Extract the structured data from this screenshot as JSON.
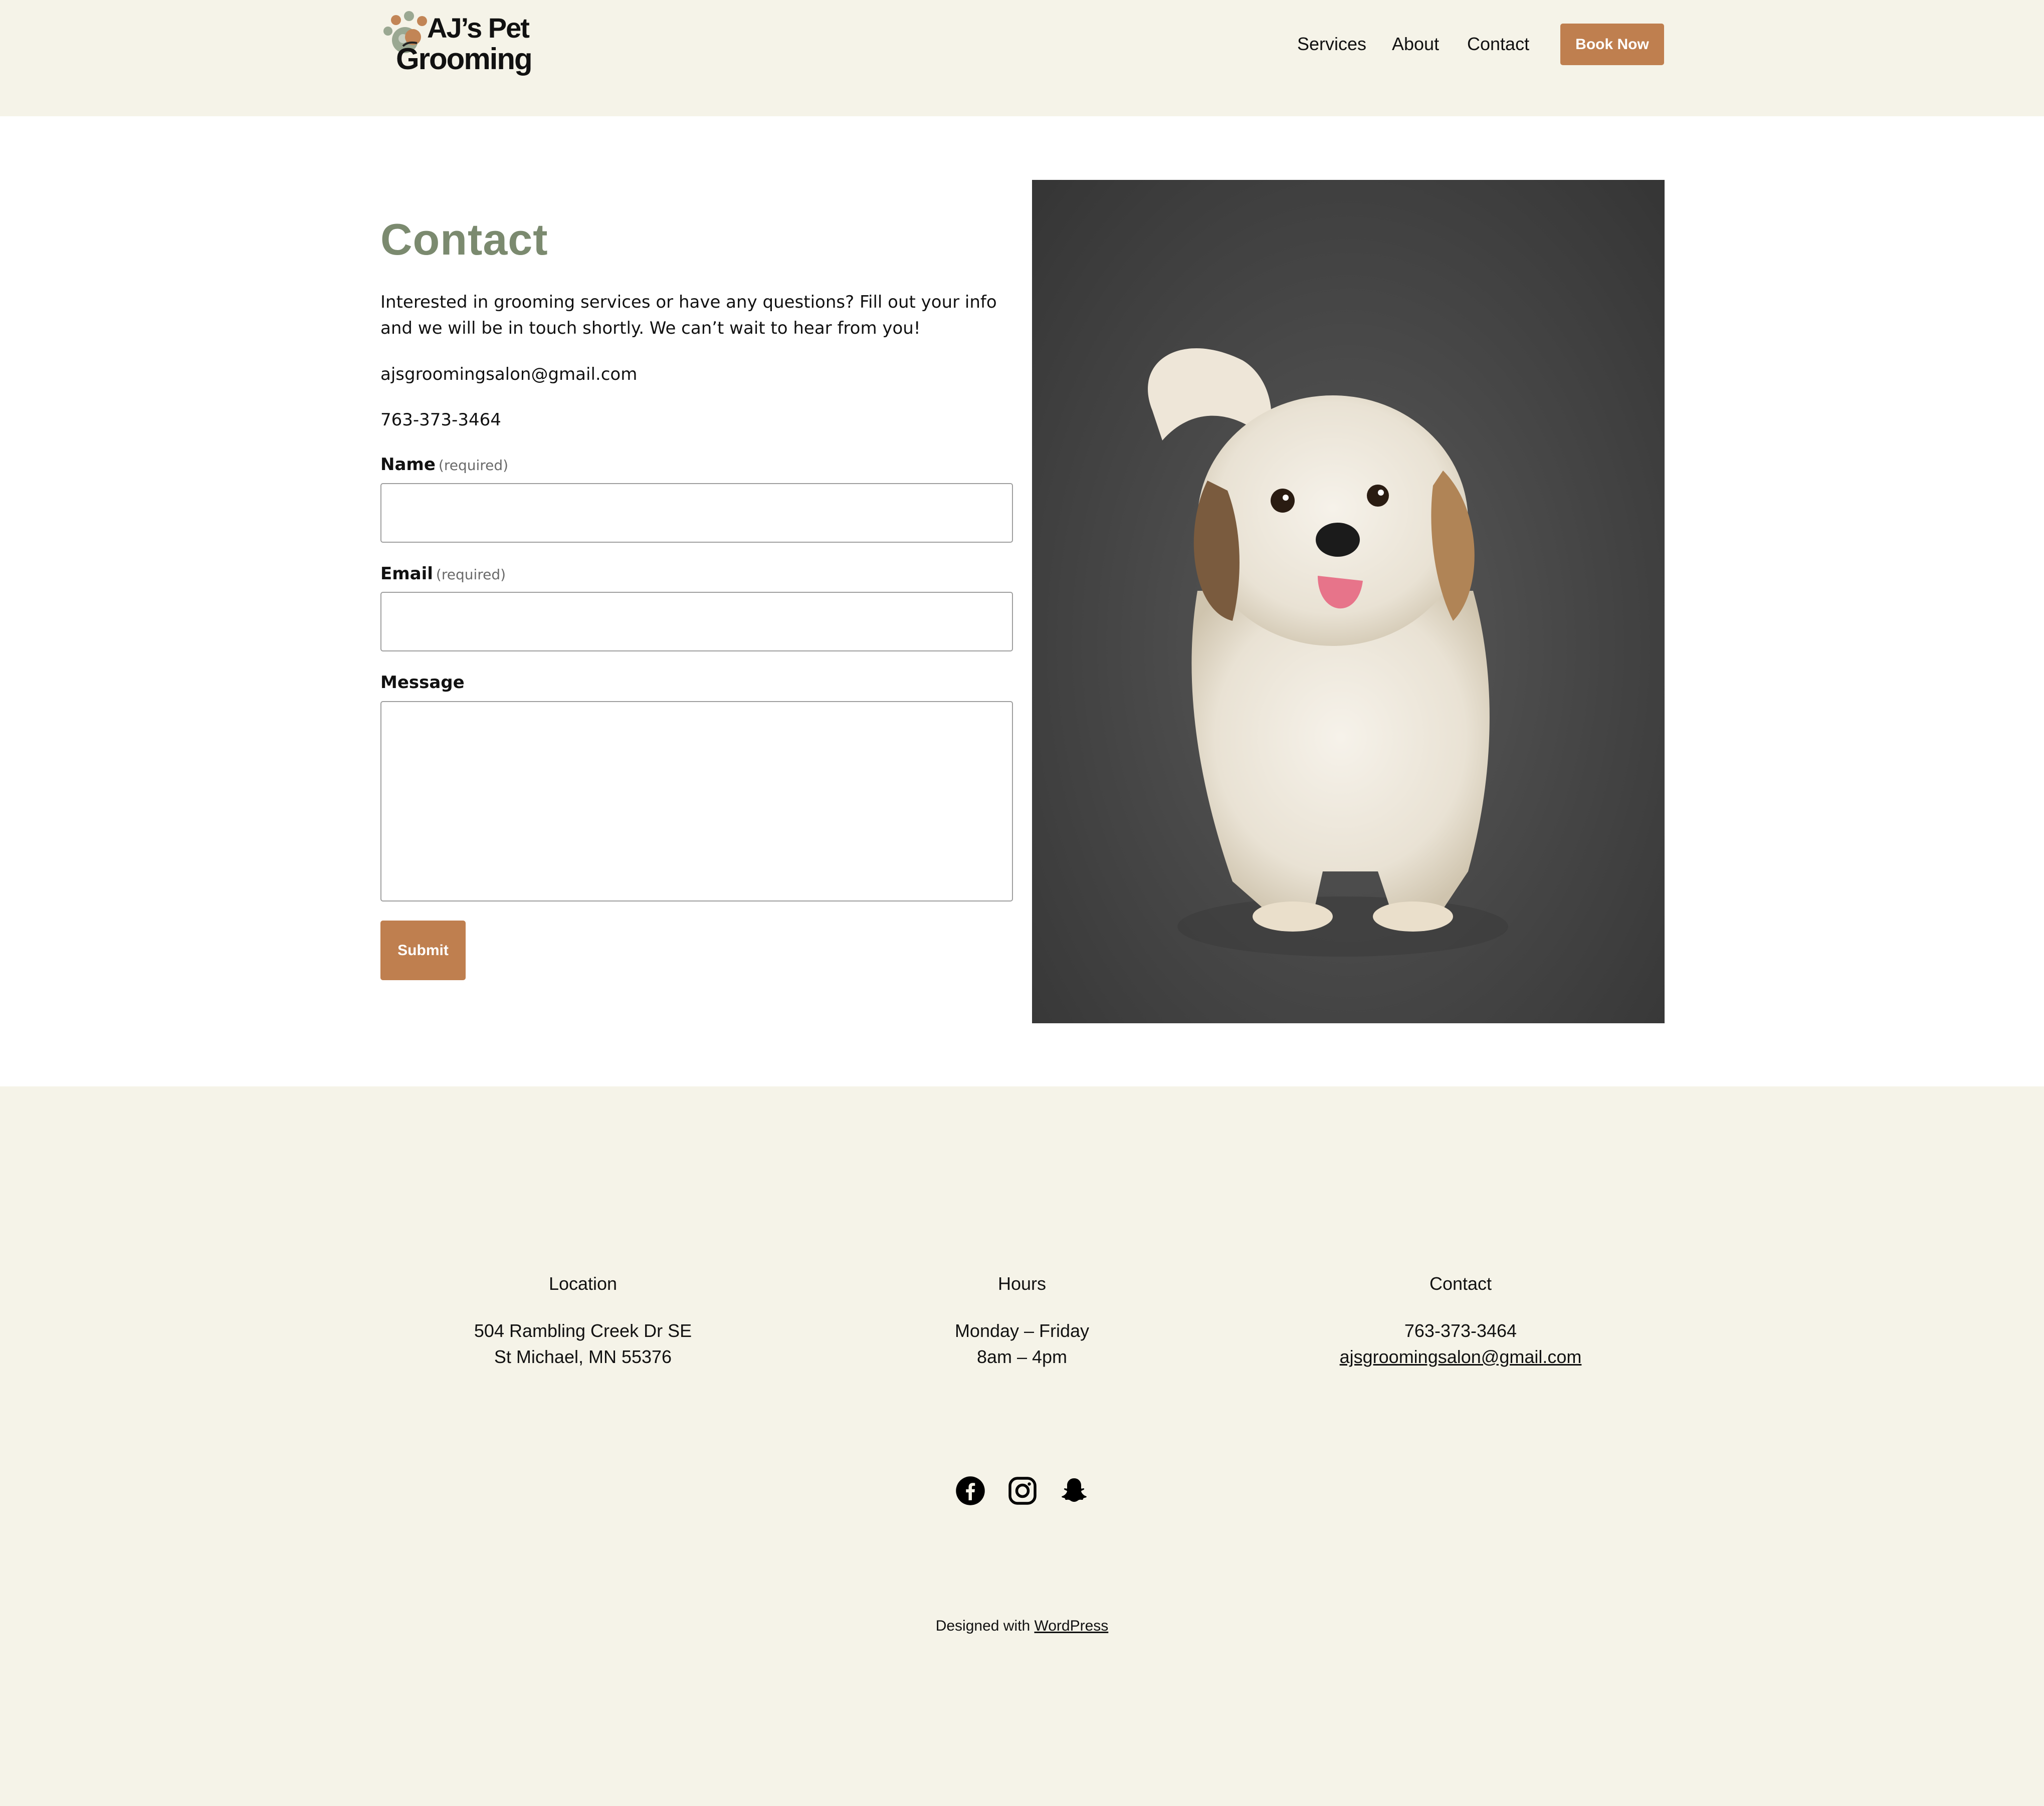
{
  "brand": {
    "name_line1": "AJ’s Pet",
    "name_line2": "Grooming",
    "logo_icon": "paw-icon",
    "accent_color": "#bf7f4f",
    "heading_color": "#7b8a6f",
    "header_bg": "#f5f3e8"
  },
  "nav": {
    "items": [
      {
        "label": "Services"
      },
      {
        "label": "About"
      },
      {
        "label": "Contact"
      }
    ],
    "cta_label": "Book Now"
  },
  "contact": {
    "title": "Contact",
    "intro": "Interested in grooming services or have any questions? Fill out your info and we will be in touch shortly. We can’t wait to hear from you!",
    "email": "ajsgroomingsalon@gmail.com",
    "phone": "763-373-3464"
  },
  "form": {
    "name_label": "Name",
    "name_required": "(required)",
    "name_value": "",
    "email_label": "Email",
    "email_required": "(required)",
    "email_value": "",
    "message_label": "Message",
    "message_value": "",
    "submit_label": "Submit"
  },
  "hero_image": {
    "subject": "white-and-tan-shih-tzu-dog-photo"
  },
  "footer": {
    "location": {
      "heading": "Location",
      "line1": "504 Rambling Creek Dr SE",
      "line2": "St Michael, MN 55376"
    },
    "hours": {
      "heading": "Hours",
      "line1": "Monday – Friday",
      "line2": "8am – 4pm"
    },
    "contact": {
      "heading": "Contact",
      "phone": "763-373-3464",
      "email": "ajsgroomingsalon@gmail.com"
    },
    "social": [
      {
        "icon": "facebook-icon"
      },
      {
        "icon": "instagram-icon"
      },
      {
        "icon": "snapchat-icon"
      }
    ],
    "credit_prefix": "Designed with ",
    "credit_link": "WordPress"
  }
}
